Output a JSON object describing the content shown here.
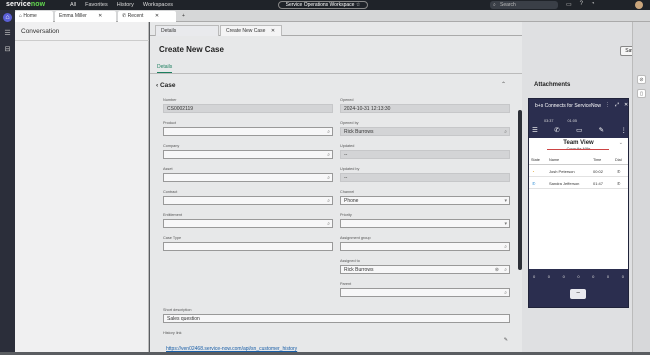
{
  "topbar": {
    "logo_main": "servicenow",
    "nav": [
      "All",
      "Favorites",
      "History",
      "Workspaces"
    ],
    "workspace": "Service Operations Workspace",
    "search_placeholder": "Search"
  },
  "workspace_tabs": {
    "home": "Home",
    "user": "Emma Miller",
    "recent": "Recent"
  },
  "conversation": {
    "title": "Conversation"
  },
  "subtabs": {
    "details": "Details",
    "create": "Create New Case"
  },
  "page": {
    "title": "Create New Case",
    "save": "Save",
    "details_tab": "Details",
    "section": "Case"
  },
  "left_fields": [
    {
      "label": "Number",
      "value": "CS0002119",
      "readonly": true
    },
    {
      "label": "Product",
      "value": "",
      "icon": "search-icon"
    },
    {
      "label": "Company",
      "value": "",
      "icon": "search-icon"
    },
    {
      "label": "Asset",
      "value": "",
      "icon": "search-icon"
    },
    {
      "label": "Contract",
      "value": "",
      "icon": "search-icon"
    },
    {
      "label": "Entitlement",
      "value": "",
      "icon": "search-icon"
    },
    {
      "label": "Case Type",
      "value": ""
    }
  ],
  "right_fields": [
    {
      "label": "Opened",
      "value": "2024-10-31 12:13:30",
      "readonly": true
    },
    {
      "label": "Opened by",
      "value": "Rick Burrows",
      "readonly": true,
      "icon": "search-icon"
    },
    {
      "label": "Updated",
      "value": "--",
      "readonly": true
    },
    {
      "label": "Updated by",
      "value": "--",
      "readonly": true
    },
    {
      "label": "Channel",
      "value": "Phone",
      "icon": "dropdown-icon"
    },
    {
      "label": "Priority",
      "value": "",
      "icon": "dropdown-icon"
    },
    {
      "label": "Assignment group",
      "value": "",
      "icon": "search-icon"
    },
    {
      "label": "Assigned to",
      "value": "Rick Burrows",
      "icon": "search-icon"
    },
    {
      "label": "Parent",
      "value": "",
      "icon": "search-icon"
    }
  ],
  "short_description": {
    "label": "Short description",
    "value": "Sales question"
  },
  "history_link": {
    "label": "History link",
    "value": "https://ven02468.service-now.com/api/sn_customer_history"
  },
  "attachments": {
    "title": "Attachments"
  },
  "widget": {
    "title": "b+s Connects for ServiceNow",
    "time1": "03:37",
    "time2": "01:05",
    "team_view": "Team View",
    "team_sub": "Consulta Mille",
    "columns": [
      "State",
      "Name",
      "Time",
      "Dial"
    ],
    "rows": [
      {
        "name": "Josh Peterson",
        "time": "00:02"
      },
      {
        "name": "Sandra Jefferson",
        "time": "01:47"
      }
    ],
    "keypad": [
      "0",
      "0",
      "0",
      "0",
      "0",
      "0",
      "0"
    ]
  },
  "colors": {
    "accent": "#1b7f5e",
    "topbar": "#1f2329",
    "widget": "#2b2e4f"
  }
}
